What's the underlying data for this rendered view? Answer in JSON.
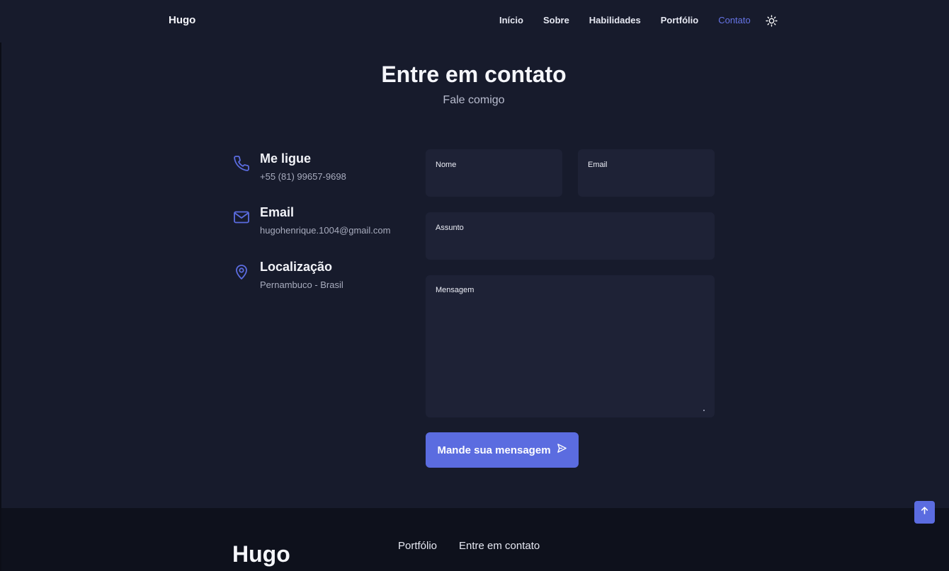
{
  "header": {
    "logo": "Hugo",
    "nav": [
      "Início",
      "Sobre",
      "Habilidades",
      "Portfólio",
      "Contato"
    ],
    "active_nav": "Contato",
    "theme_icon": "sun-icon"
  },
  "section": {
    "title": "Entre em contato",
    "subtitle": "Fale comigo"
  },
  "contact_info": [
    {
      "icon": "phone-icon",
      "title": "Me ligue",
      "value": "+55 (81) 99657-9698"
    },
    {
      "icon": "mail-icon",
      "title": "Email",
      "value": "hugohenrique.1004@gmail.com"
    },
    {
      "icon": "map-pin-icon",
      "title": "Localização",
      "value": "Pernambuco - Brasil"
    }
  ],
  "form": {
    "name_label": "Nome",
    "email_label": "Email",
    "subject_label": "Assunto",
    "message_label": "Mensagem",
    "submit_label": "Mande sua mensagem",
    "submit_icon": "send-icon"
  },
  "footer": {
    "logo": "Hugo",
    "links": [
      "Portfólio",
      "Entre em contato"
    ]
  },
  "scroll_top_icon": "arrow-up-icon",
  "colors": {
    "background": "#171b2c",
    "accent": "#5b6ce0",
    "field": "#1e2236",
    "footer": "#0e111c"
  }
}
